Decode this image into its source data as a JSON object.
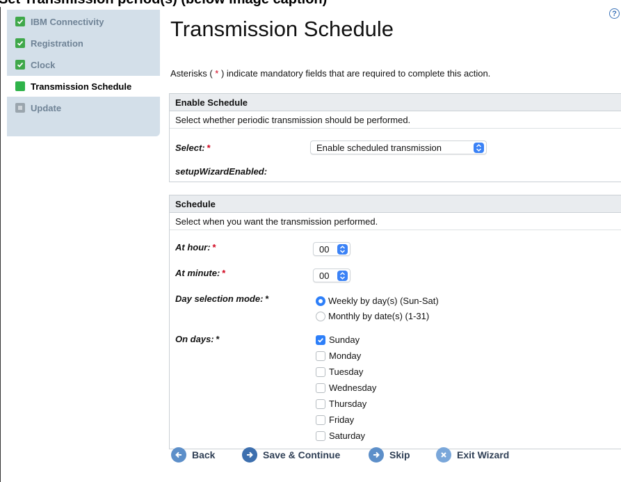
{
  "cut_heading": "Set Transmission period(s) (below image caption)",
  "sidebar": {
    "items": [
      {
        "label": "IBM Connectivity",
        "state": "done"
      },
      {
        "label": "Registration",
        "state": "done"
      },
      {
        "label": "Clock",
        "state": "done"
      },
      {
        "label": "Transmission Schedule",
        "state": "current"
      },
      {
        "label": "Update",
        "state": "pending"
      }
    ]
  },
  "help_icon": "?",
  "page_title": "Transmission Schedule",
  "mandatory_note": {
    "pre": "Asterisks ( ",
    "star": "*",
    "post": " ) indicate mandatory fields that are required to complete this action."
  },
  "enable_schedule": {
    "header": "Enable Schedule",
    "description": "Select whether periodic transmission should be performed.",
    "select_label": "Select:",
    "select_value": "Enable scheduled transmission",
    "wizard_label": "setupWizardEnabled:"
  },
  "schedule": {
    "header": "Schedule",
    "description": "Select when you want the transmission performed.",
    "hour_label": "At hour:",
    "hour_value": "00",
    "minute_label": "At minute:",
    "minute_value": "00",
    "day_mode_label": "Day selection mode:",
    "day_modes": [
      {
        "label": "Weekly by day(s) (Sun-Sat)",
        "selected": true
      },
      {
        "label": "Monthly by date(s) (1-31)",
        "selected": false
      }
    ],
    "days_label": "On days:",
    "days": [
      {
        "label": "Sunday",
        "checked": true
      },
      {
        "label": "Monday",
        "checked": false
      },
      {
        "label": "Tuesday",
        "checked": false
      },
      {
        "label": "Wednesday",
        "checked": false
      },
      {
        "label": "Thursday",
        "checked": false
      },
      {
        "label": "Friday",
        "checked": false
      },
      {
        "label": "Saturday",
        "checked": false
      }
    ]
  },
  "star": "*",
  "buttons": {
    "back": "Back",
    "save": "Save & Continue",
    "skip": "Skip",
    "exit": "Exit Wizard"
  },
  "colors": {
    "accent": "#2d7ff9",
    "done": "#3fa84a",
    "required": "#d0021b",
    "sidebar_bg": "#d3dfe9"
  }
}
